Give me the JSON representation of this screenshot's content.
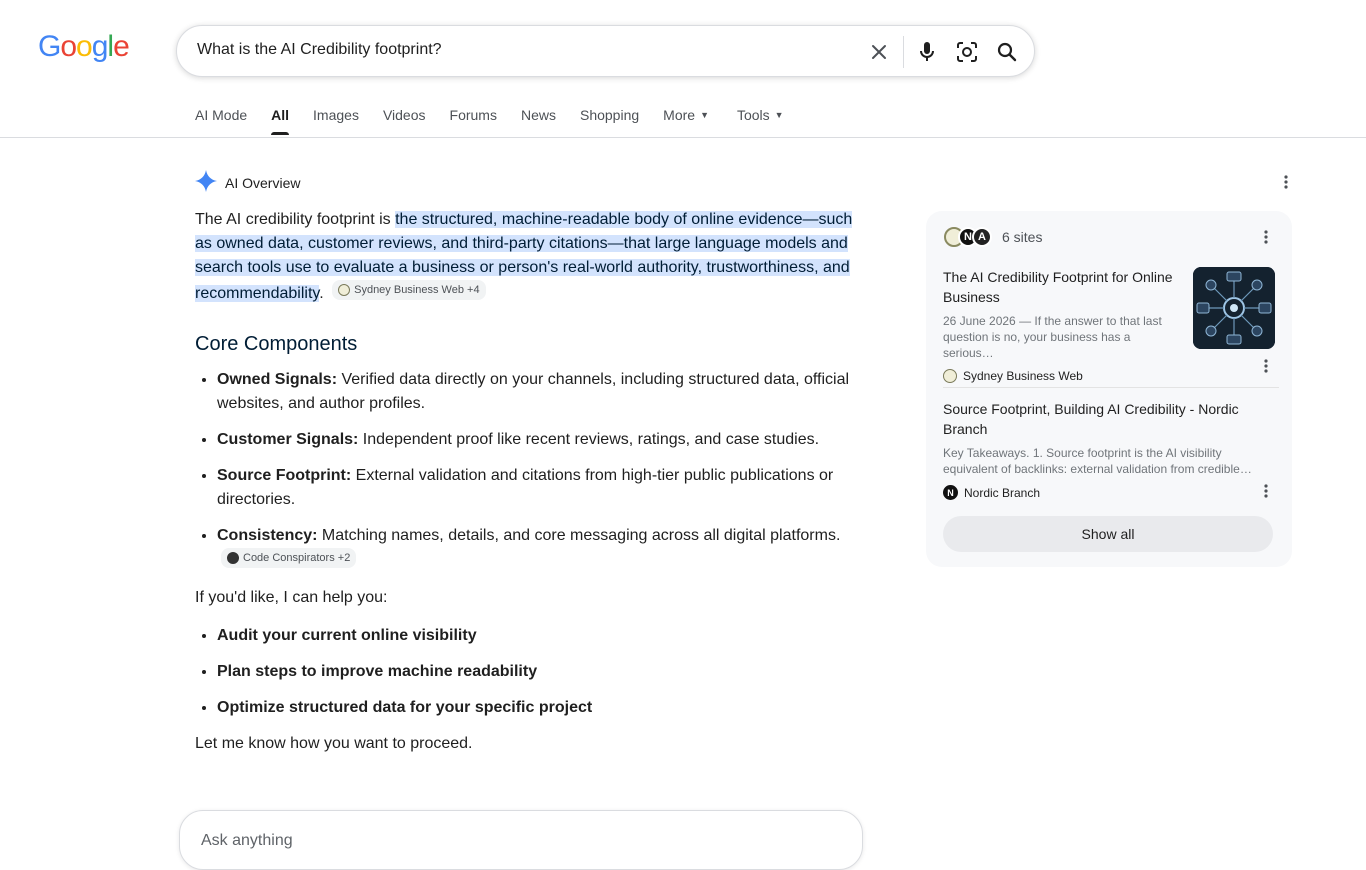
{
  "logo": {
    "letters": [
      "G",
      "o",
      "o",
      "g",
      "l",
      "e"
    ],
    "colors": [
      "#4285F4",
      "#EA4335",
      "#FBBC05",
      "#4285F4",
      "#34A853",
      "#EA4335"
    ]
  },
  "search": {
    "query": "What is the AI Credibility footprint?"
  },
  "tabs": [
    {
      "label": "AI Mode"
    },
    {
      "label": "All"
    },
    {
      "label": "Images"
    },
    {
      "label": "Videos"
    },
    {
      "label": "Forums"
    },
    {
      "label": "News"
    },
    {
      "label": "Shopping"
    },
    {
      "label": "More"
    },
    {
      "label": "Tools"
    }
  ],
  "ai_overview": {
    "heading": "AI Overview",
    "intro_prefix": "The AI credibility footprint is ",
    "intro_highlight": "the structured, machine-readable body of online evidence—such as owned data, customer reviews, and third-party citations—that large language models and search tools use to evaluate a business or person's real-world authority, trustworthiness, and recommendability",
    "intro_suffix": ".",
    "intro_citation": "Sydney Business Web +4",
    "core_heading": "Core Components",
    "components": [
      {
        "label": "Owned Signals:",
        "text": " Verified data directly on your channels, including structured data, official websites, and author profiles."
      },
      {
        "label": "Customer Signals:",
        "text": " Independent proof like recent reviews, ratings, and case studies."
      },
      {
        "label": "Source Footprint:",
        "text": " External validation and citations from high-tier public publications or directories."
      },
      {
        "label": "Consistency:",
        "text": " Matching names, details, and core messaging across all digital platforms."
      }
    ],
    "components_citation": "Code Conspirators +2",
    "help_intro": "If you'd like, I can help you:",
    "actions": [
      "Audit your current online visibility",
      "Plan steps to improve machine readability",
      "Optimize structured data for your specific project"
    ],
    "closing": "Let me know how you want to proceed."
  },
  "sources": {
    "count_label": "6 sites",
    "items": [
      {
        "title": "The AI Credibility Footprint for Online Business",
        "snippet": "26 June 2026 — If the answer to that last question is no, your business has a serious…",
        "site": "Sydney Business Web"
      },
      {
        "title": "Source Footprint, Building AI Credibility - Nordic Branch",
        "snippet": "Key Takeaways. 1. Source footprint is the AI visibility equivalent of backlinks: external validation from credible…",
        "site": "Nordic Branch"
      }
    ],
    "show_all": "Show all"
  },
  "ask": {
    "placeholder": "Ask anything"
  }
}
